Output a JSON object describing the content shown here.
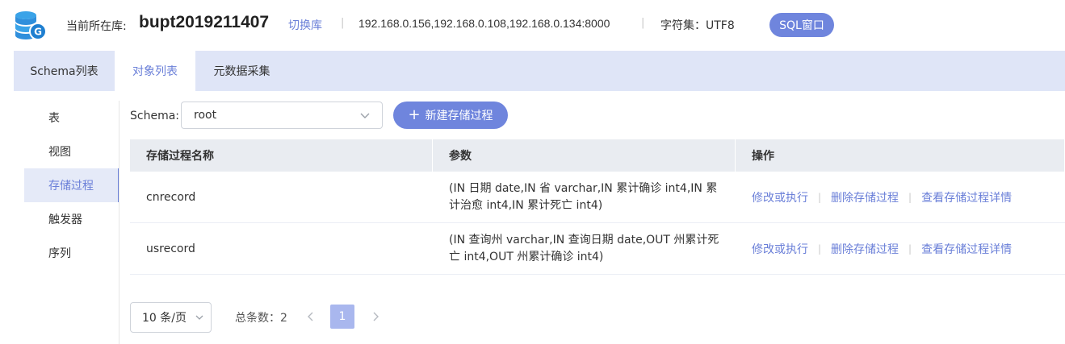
{
  "header": {
    "logo_icon": "database-gauss-icon",
    "current_db_label": "当前所在库:",
    "db_name": "bupt2019211407",
    "switch_db": "切换库",
    "hosts": "192.168.0.156,192.168.0.108,192.168.0.134:8000",
    "charset": "字符集：UTF8",
    "sql_window": "SQL窗口"
  },
  "tabs": [
    {
      "label": "Schema列表",
      "active": false
    },
    {
      "label": "对象列表",
      "active": true
    },
    {
      "label": "元数据采集",
      "active": false
    }
  ],
  "sidenav": [
    {
      "label": "表",
      "active": false
    },
    {
      "label": "视图",
      "active": false
    },
    {
      "label": "存储过程",
      "active": true
    },
    {
      "label": "触发器",
      "active": false
    },
    {
      "label": "序列",
      "active": false
    }
  ],
  "toolbar": {
    "schema_label": "Schema:",
    "schema_value": "root",
    "new_button": "新建存储过程"
  },
  "table": {
    "headers": [
      "存储过程名称",
      "参数",
      "操作"
    ],
    "rows": [
      {
        "name": "cnrecord",
        "params": "(IN 日期 date,IN 省 varchar,IN 累计确诊 int4,IN 累计治愈 int4,IN 累计死亡 int4)",
        "ops": [
          "修改或执行",
          "删除存储过程",
          "查看存储过程详情"
        ]
      },
      {
        "name": "usrecord",
        "params": "(IN 查询州 varchar,IN 查询日期 date,OUT 州累计死亡 int4,OUT 州累计确诊 int4)",
        "ops": [
          "修改或执行",
          "删除存储过程",
          "查看存储过程详情"
        ]
      }
    ]
  },
  "pagination": {
    "page_size": "10 条/页",
    "total": "总条数：2",
    "current_page": "1"
  },
  "colors": {
    "accent": "#6f85dd",
    "link": "#6a7fd8",
    "tabbar_bg": "#dfe5f7"
  }
}
